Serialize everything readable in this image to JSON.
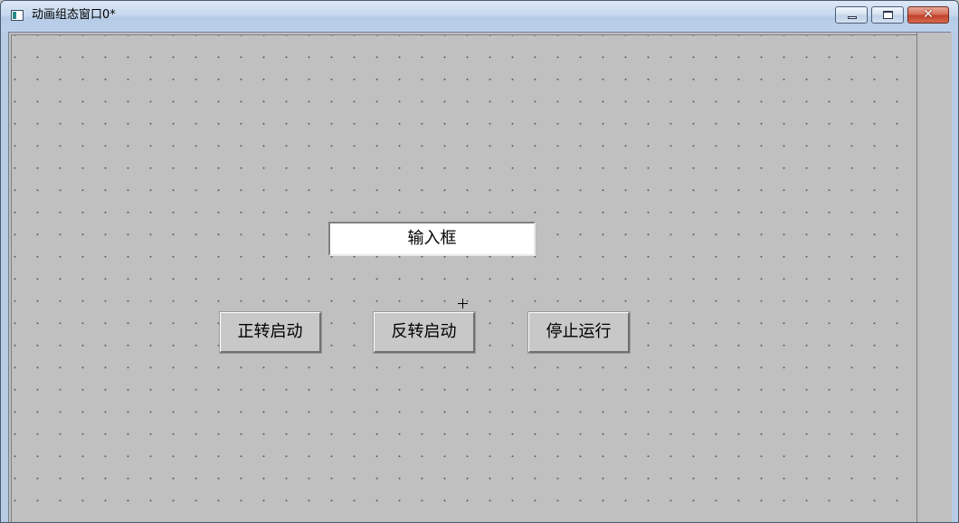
{
  "window": {
    "title": "动画组态窗口0*",
    "close_glyph": "✕"
  },
  "icons": {
    "app": "window-app-icon",
    "minimize": "minimize-icon",
    "maximize": "maximize-icon",
    "close": "close-icon",
    "cursor": "crosshair-cursor-icon"
  },
  "canvas": {
    "input_box": {
      "value": "输入框"
    },
    "buttons": [
      {
        "label": "正转启动"
      },
      {
        "label": "反转启动"
      },
      {
        "label": "停止运行"
      }
    ]
  },
  "colors": {
    "canvas_background": "#c0c0c0",
    "titlebar": "#c6d8ee",
    "close_button": "#c2412a",
    "grid_dot": "#5a5a5a"
  }
}
